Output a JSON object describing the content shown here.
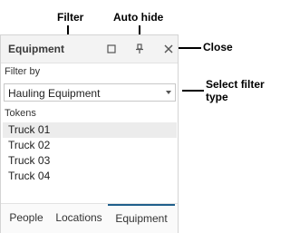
{
  "callouts": {
    "filter": "Filter",
    "auto_hide": "Auto hide",
    "close": "Close",
    "select_filter_type_line1": "Select filter",
    "select_filter_type_line2": "type"
  },
  "panel": {
    "title": "Equipment",
    "header_icons": [
      "maximize-icon",
      "pin-icon",
      "close-icon"
    ]
  },
  "filter": {
    "label": "Filter by",
    "selected_value": "Hauling Equipment"
  },
  "tokens": {
    "label": "Tokens",
    "items": [
      {
        "label": "Truck 01",
        "selected": true
      },
      {
        "label": "Truck 02",
        "selected": false
      },
      {
        "label": "Truck 03",
        "selected": false
      },
      {
        "label": "Truck 04",
        "selected": false
      }
    ]
  },
  "tabs": [
    {
      "label": "People",
      "active": false
    },
    {
      "label": "Locations",
      "active": false
    },
    {
      "label": "Equipment",
      "active": true
    }
  ]
}
